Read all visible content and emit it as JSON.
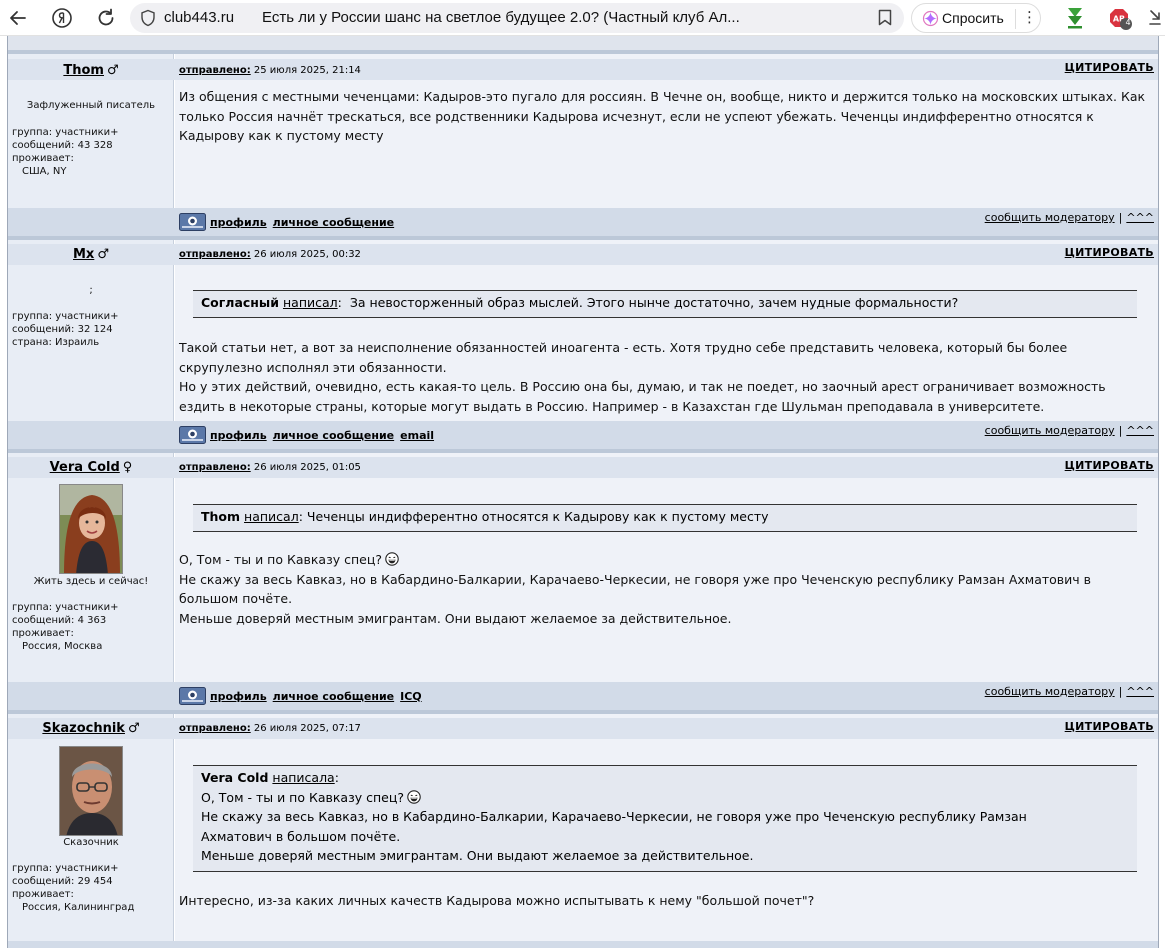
{
  "browser": {
    "domain": "club443.ru",
    "tab_title": "Есть ли у России шанс на светлое будущее 2.0? (Частный клуб Ал...",
    "ask_label": "Спросить",
    "adblock_badge": "4",
    "accent": "#a64dff"
  },
  "labels": {
    "posted": "отправлено:",
    "cite": "ЦИТИРОВАТЬ",
    "profile": "профиль",
    "pm": "личное сообщение",
    "report": "сообщить модератору",
    "top": "^^^",
    "sep": "|",
    "group_label": "группа:",
    "posts_label": "сообщений:",
    "lives_label": "проживает:",
    "country_label": "страна:"
  },
  "posts": [
    {
      "username": "Thom",
      "gender": "♂",
      "user_title": "Зафлуженный писатель",
      "group": "участники+",
      "posts": "43 328",
      "location_label": "проживает:",
      "location": "США, NY",
      "date": "25 июля 2025, 21:14",
      "body": [
        "Из общения с местными чеченцами: Кадыров-это пугало для россиян. В Чечне он, вообще, никто и держится только на московских штыках. Как только Россия начнёт трескаться, все родственники Кадырова исчезнут, если не успеют убежать. Чеченцы индифферентно относятся к Кадырову как к пустому месту"
      ],
      "extra_link": ""
    },
    {
      "username": "Mx",
      "gender": "♂",
      "user_title": ";",
      "group": "участники+",
      "posts": "32 124",
      "location_label": "страна:",
      "location": "Израиль",
      "date": "26 июля 2025, 00:32",
      "quote_author": "Согласный",
      "quote_wrote": "написал",
      "quote": [
        "За невосторженный образ мыслей. Этого нынче достаточно, зачем нудные формальности?"
      ],
      "body": [
        "Такой статьи нет, а вот за неисполнение обязанностей иноагента - есть. Хотя трудно себе представить человека, который бы более скрупулезно исполнял эти обязанности.",
        "Но у этих действий, очевидно, есть какая-то цель. В Россию она бы, думаю, и так не поедет, но заочный арест ограничивает возможность ездить в некоторые страны, которые могут выдать в Россию. Например - в Казахстан где Шульман преподавала в университете."
      ],
      "extra_link": "email"
    },
    {
      "username": "Vera Cold",
      "gender": "♀",
      "user_title": "Жить здесь и сейчас!",
      "group": "участники+",
      "posts": "4 363",
      "location_label": "проживает:",
      "location": "Россия, Москва",
      "date": "26 июля 2025, 01:05",
      "quote_author": "Thom",
      "quote_wrote": "написал",
      "quote": [
        "Чеченцы индифферентно относятся к Кадырову как к пустому месту"
      ],
      "body_first": "О, Том - ты и по Кавказу спец?",
      "body": [
        "Не скажу за весь Кавказ, но в Кабардино-Балкарии, Карачаево-Черкесии, не говоря уже про Чеченскую республику Рамзан Ахматович в большом почёте.",
        "Меньше доверяй местным эмигрантам. Они выдают желаемое за действительное."
      ],
      "extra_link": "ICQ"
    },
    {
      "username": "Skazochnik",
      "gender": "♂",
      "user_title": "Сказочник",
      "group": "участники+",
      "posts": "29 454",
      "location_label": "проживает:",
      "location": "Россия, Калининград",
      "date": "26 июля 2025, 07:17",
      "quote_author": "Vera Cold",
      "quote_wrote": "написала",
      "quote_first": "О, Том - ты и по Кавказу спец?",
      "quote": [
        "Не скажу за весь Кавказ, но в Кабардино-Балкарии, Карачаево-Черкесии, не говоря уже про Чеченскую республику Рамзан Ахматович в большом почёте.",
        "Меньше доверяй местным эмигрантам. Они выдают желаемое за действительное."
      ],
      "body": [
        "Интересно, из-за каких личных качеств Кадырова можно испытывать к нему \"большой почет\"?"
      ],
      "extra_link": ""
    }
  ]
}
